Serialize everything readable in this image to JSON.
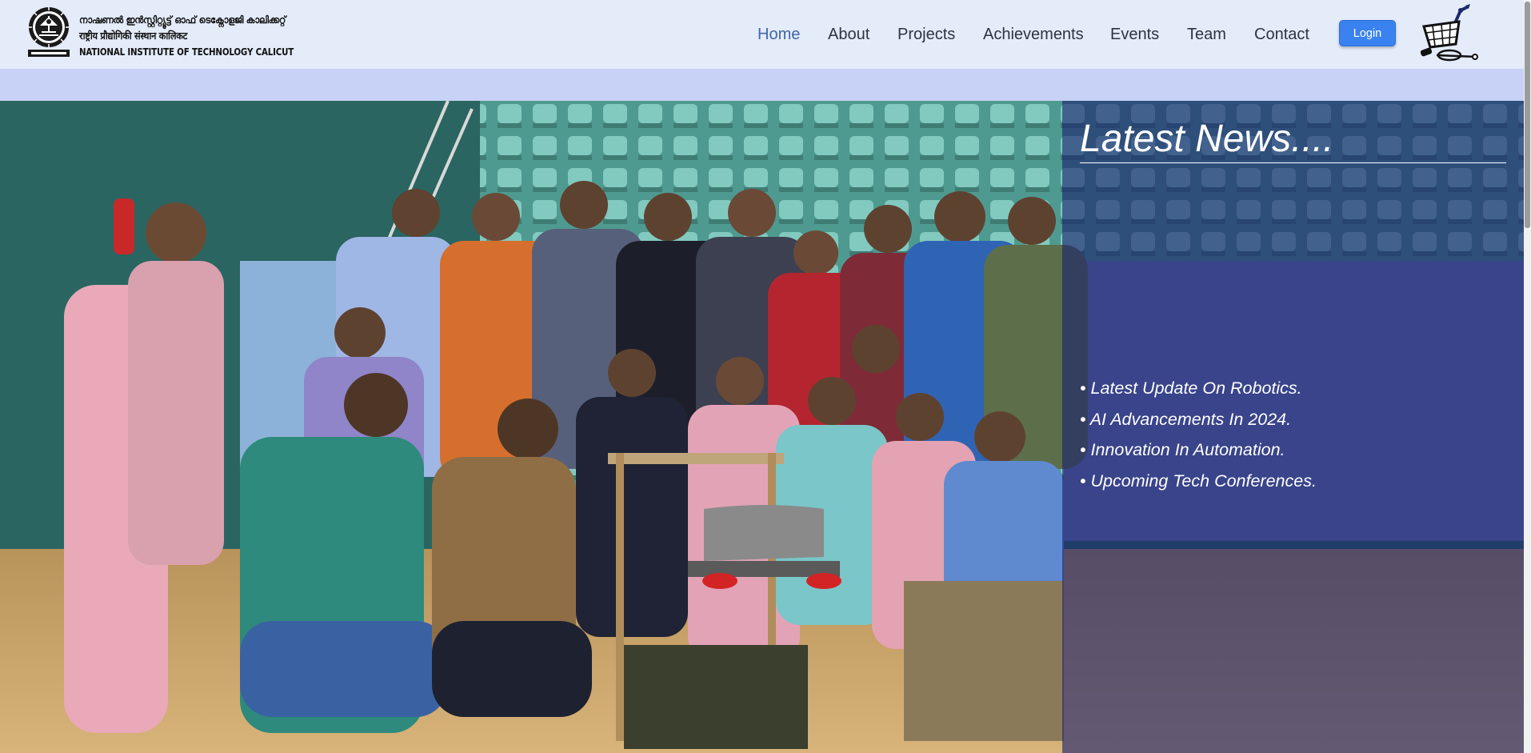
{
  "header": {
    "logo_lines": [
      "നാഷണൽ ഇൻസ്റ്റിറ്റ്യൂട്ട് ഓഫ് ടെക്നോളജി കാലിക്കറ്റ്",
      "राष्ट्रीय प्रौद्योगिकी संस्थान कालिकट",
      "NATIONAL INSTITUTE OF TECHNOLOGY CALICUT"
    ],
    "nav": [
      {
        "label": "Home",
        "active": true
      },
      {
        "label": "About"
      },
      {
        "label": "Projects"
      },
      {
        "label": "Achievements"
      },
      {
        "label": "Events"
      },
      {
        "label": "Team"
      },
      {
        "label": "Contact"
      }
    ],
    "login_label": "Login",
    "colors": {
      "header_bg": "#e4ebf9",
      "strip_bg": "#c7d2f6",
      "login_bg": "#3a82f0",
      "active_link": "#3f67a8"
    }
  },
  "hero": {
    "image_icon": "team-group-photo",
    "news": {
      "title": "Latest News....",
      "items": [
        "• Latest Update On Robotics.",
        "• AI Advancements In 2024.",
        "• Innovation In Automation.",
        "• Upcoming Tech Conferences."
      ],
      "panel_color": "#1c226e"
    }
  }
}
